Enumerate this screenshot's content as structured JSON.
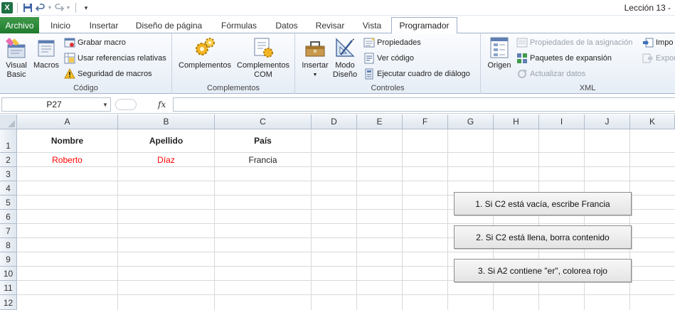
{
  "window": {
    "title": "Lección 13 -"
  },
  "tabs": {
    "file": "Archivo",
    "items": [
      "Inicio",
      "Insertar",
      "Diseño de página",
      "Fórmulas",
      "Datos",
      "Revisar",
      "Vista",
      "Programador"
    ],
    "active": "Programador"
  },
  "ribbon": {
    "codigo": {
      "label": "Código",
      "visual_basic": [
        "Visual",
        "Basic"
      ],
      "macros": "Macros",
      "grabar_macro": "Grabar macro",
      "usar_referencias": "Usar referencias relativas",
      "seguridad": "Seguridad de macros"
    },
    "complementos": {
      "label": "Complementos",
      "complementos": "Complementos",
      "complementos_com": [
        "Complementos",
        "COM"
      ]
    },
    "controles": {
      "label": "Controles",
      "insertar": "Insertar",
      "modo_diseno": [
        "Modo",
        "Diseño"
      ],
      "propiedades": "Propiedades",
      "ver_codigo": "Ver código",
      "ejecutar_cuadro": "Ejecutar cuadro de diálogo"
    },
    "xml": {
      "label": "XML",
      "origen": "Origen",
      "propiedades_asignacion": "Propiedades de la asignación",
      "paquetes_expansion": "Paquetes de expansión",
      "actualizar_datos": "Actualizar datos",
      "importar": "Impo",
      "exportar": "Expor"
    }
  },
  "formula_bar": {
    "name_box": "P27",
    "fx": "fx",
    "value": ""
  },
  "sheet": {
    "columns": [
      "A",
      "B",
      "C",
      "D",
      "E",
      "F",
      "G",
      "H",
      "I",
      "J",
      "K"
    ],
    "rows": [
      "1",
      "2",
      "3",
      "4",
      "5",
      "6",
      "7",
      "8",
      "9",
      "10",
      "11",
      "12"
    ],
    "headers": {
      "A1": "Nombre",
      "B1": "Apellido",
      "C1": "País"
    },
    "values": {
      "A2": "Roberto",
      "B2": "Díaz",
      "C2": "Francia"
    },
    "colors": {
      "red_text": "#ff0000"
    }
  },
  "buttons": [
    "1. Si C2 está vacía, escribe Francia",
    "2. Si C2 está llena, borra contenido",
    "3. Si A2 contiene \"er\", colorea rojo"
  ]
}
